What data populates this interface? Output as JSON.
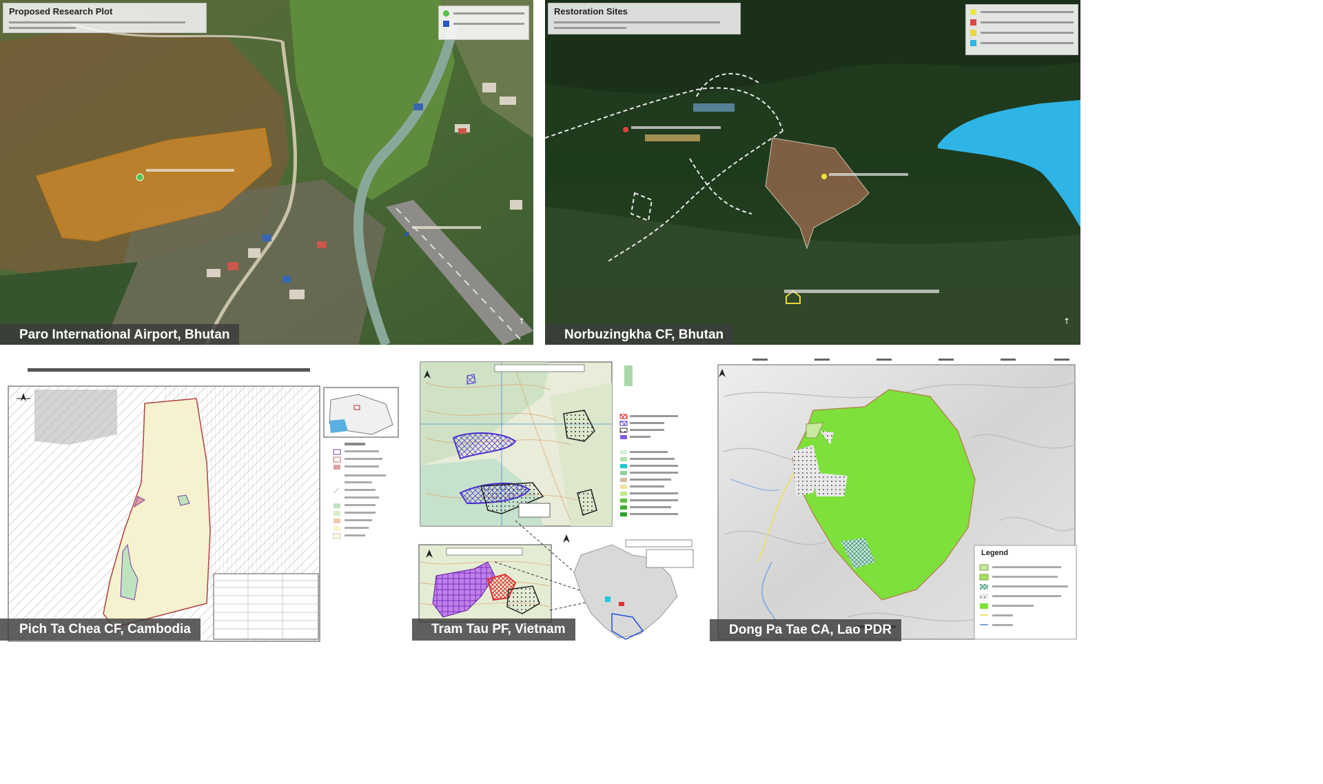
{
  "panels": [
    {
      "caption": "Paro International Airport, Bhutan",
      "title": "Proposed Research Plot"
    },
    {
      "caption": "Norbuzingkha CF, Bhutan",
      "title": "Restoration Sites"
    },
    {
      "caption": "Pich Ta Chea CF, Cambodia"
    },
    {
      "caption": "Tram Tau PF, Vietnam"
    },
    {
      "caption": "Dong Pa Tae CA, Lao PDR",
      "legend_title": "Legend"
    }
  ],
  "colors": {
    "plot_orange": "#c9862a",
    "plot_brown": "#8a6448",
    "lake_blue": "#2fb4e6",
    "lao_green": "#7ee03a",
    "caption_bg": "#3c3c3c"
  },
  "icons": [
    "north-arrow-icon",
    "map-pin-icon",
    "airplane-icon",
    "building-icon"
  ]
}
